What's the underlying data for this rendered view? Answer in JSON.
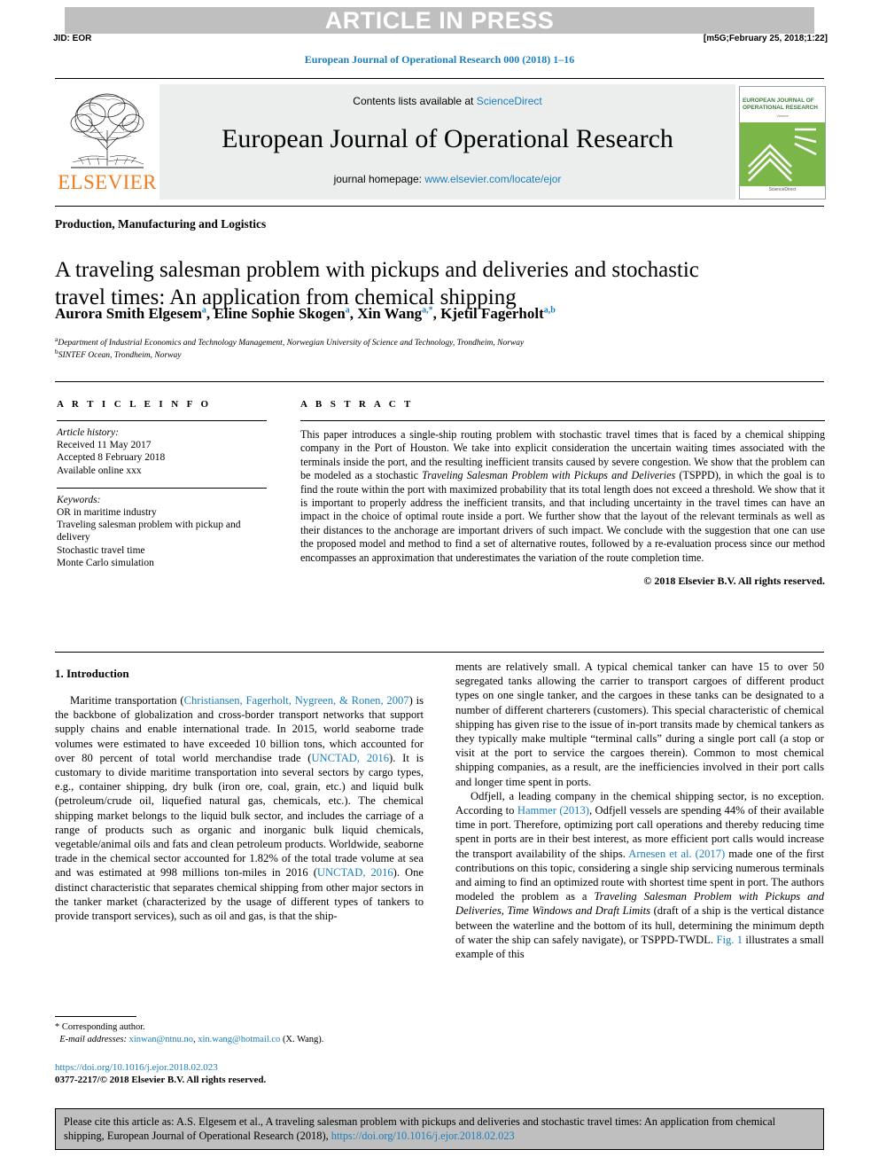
{
  "header": {
    "press_banner": "ARTICLE IN PRESS",
    "jid": "JID: EOR",
    "stamp": "[m5G;February 25, 2018;1:22]",
    "journal_ref": "European Journal of Operational Research 000 (2018) 1–16"
  },
  "masthead": {
    "contents_prefix": "Contents lists available at ",
    "contents_link": "ScienceDirect",
    "journal_name": "European Journal of Operational Research",
    "homepage_prefix": "journal homepage: ",
    "homepage_link": "www.elsevier.com/locate/ejor",
    "publisher": "ELSEVIER",
    "cover_title": "EUROPEAN JOURNAL OF OPERATIONAL RESEARCH",
    "cover_sub": "Volume",
    "cover_bottom": "ScienceDirect"
  },
  "title_block": {
    "section_label": "Production, Manufacturing and Logistics",
    "title": "A traveling salesman problem with pickups and deliveries and stochastic travel times: An application from chemical shipping",
    "authors": [
      {
        "name": "Aurora Smith Elgesem",
        "marks": "a",
        "sep": ", "
      },
      {
        "name": "Eline Sophie Skogen",
        "marks": "a",
        "sep": ", "
      },
      {
        "name": "Xin Wang",
        "marks": "a,*",
        "sep": ", "
      },
      {
        "name": "Kjetil Fagerholt",
        "marks": "a,b",
        "sep": ""
      }
    ],
    "affiliations": [
      {
        "mark": "a",
        "text": "Department of Industrial Economics and Technology Management, Norwegian University of Science and Technology, Trondheim, Norway"
      },
      {
        "mark": "b",
        "text": "SINTEF Ocean, Trondheim, Norway"
      }
    ]
  },
  "article_info": {
    "heading": "A R T I C L E    I N F O",
    "history_label": "Article history:",
    "history": [
      "Received 11 May 2017",
      "Accepted 8 February 2018",
      "Available online xxx"
    ],
    "keywords_label": "Keywords:",
    "keywords": [
      "OR in maritime industry",
      "Traveling salesman problem with pickup and delivery",
      "Stochastic travel time",
      "Monte Carlo simulation"
    ]
  },
  "abstract": {
    "heading": "A B S T R A C T",
    "part1": "This paper introduces a single-ship routing problem with stochastic travel times that is faced by a chemical shipping company in the Port of Houston. We take into explicit consideration the uncertain waiting times associated with the terminals inside the port, and the resulting inefficient transits caused by severe congestion. We show that the problem can be modeled as a stochastic ",
    "italic1": "Traveling Salesman Problem with Pickups and Deliveries",
    "part2": " (TSPPD), in which the goal is to find the route within the port with maximized probability that its total length does not exceed a threshold. We show that it is important to properly address the inefficient transits, and that including uncertainty in the travel times can have an impact in the choice of optimal route inside a port. We further show that the layout of the relevant terminals as well as their distances to the anchorage are important drivers of such impact. We conclude with the suggestion that one can use the proposed model and method to find a set of alternative routes, followed by a re-evaluation process since our method encompasses an approximation that underestimates the variation of the route completion time.",
    "copyright": "© 2018 Elsevier B.V. All rights reserved."
  },
  "body": {
    "intro_heading": "1. Introduction",
    "left_p1_a": "Maritime transportation (",
    "left_p1_cite1": "Christiansen, Fagerholt, Nygreen, & Ronen, 2007",
    "left_p1_b": ") is the backbone of globalization and cross-border transport networks that support supply chains and enable international trade. In 2015, world seaborne trade volumes were estimated to have exceeded 10 billion tons, which accounted for over 80 percent of total world merchandise trade (",
    "left_p1_cite2": "UNCTAD, 2016",
    "left_p1_c": "). It is customary to divide maritime transportation into several sectors by cargo types, e.g., container shipping, dry bulk (iron ore, coal, grain, etc.) and liquid bulk (petroleum/crude oil, liquefied natural gas, chemicals, etc.). The chemical shipping market belongs to the liquid bulk sector, and includes the carriage of a range of products such as organic and inorganic bulk liquid chemicals, vegetable/animal oils and fats and clean petroleum products. Worldwide, seaborne trade in the chemical sector accounted for 1.82% of the total trade volume at sea and was estimated at 998 millions ton-miles in 2016 (",
    "left_p1_cite3": "UNCTAD, 2016",
    "left_p1_d": "). One distinct characteristic that separates chemical shipping from other major sectors in the tanker market (characterized by the usage of different types of tankers to provide transport services), such as oil and gas, is that the ship-",
    "right_p1": "ments are relatively small. A typical chemical tanker can have 15 to over 50 segregated tanks allowing the carrier to transport cargoes of different product types on one single tanker, and the cargoes in these tanks can be designated to a number of different charterers (customers). This special characteristic of chemical shipping has given rise to the issue of in-port transits made by chemical tankers as they typically make multiple “terminal calls” during a single port call (a stop or visit at the port to service the cargoes therein). Common to most chemical shipping companies, as a result, are the inefficiencies involved in their port calls and longer time spent in ports.",
    "right_p2_a": "Odfjell, a leading company in the chemical shipping sector, is no exception. According to ",
    "right_p2_cite1": "Hammer (2013)",
    "right_p2_b": ", Odfjell vessels are spending 44% of their available time in port. Therefore, optimizing port call operations and thereby reducing time spent in ports are in their best interest, as more efficient port calls would increase the transport availability of the ships. ",
    "right_p2_cite2": "Arnesen et al. (2017)",
    "right_p2_c": " made one of the first contributions on this topic, considering a single ship servicing numerous terminals and aiming to find an optimized route with shortest time spent in port. The authors modeled the problem as a ",
    "right_p2_italic": "Traveling Salesman Problem with Pickups and Deliveries, Time Windows and Draft Limits",
    "right_p2_d": " (draft of a ship is the vertical distance between the waterline and the bottom of its hull, determining the minimum depth of water the ship can safely navigate), or TSPPD-TWDL. ",
    "right_p2_cite3": "Fig. 1",
    "right_p2_e": " illustrates a small example of this"
  },
  "footnote": {
    "corresponding": "Corresponding author.",
    "email_label": "E-mail addresses:",
    "email1": "xinwan@ntnu.no",
    "email2": "xin.wang@hotmail.co",
    "email_owner": "(X. Wang).",
    "doi": "https://doi.org/10.1016/j.ejor.2018.02.023",
    "issn": "0377-2217/© 2018 Elsevier B.V. All rights reserved."
  },
  "cite_box": {
    "text": "Please cite this article as: A.S. Elgesem et al., A traveling salesman problem with pickups and deliveries and stochastic travel times: An application from chemical shipping, European Journal of Operational Research (2018), ",
    "link": "https://doi.org/10.1016/j.ejor.2018.02.023"
  },
  "colors": {
    "link": "#1b7fbd",
    "banner_gray": "#bfbfbf",
    "elsevier_orange": "#ef7c20",
    "cover_green": "#7ab648"
  }
}
